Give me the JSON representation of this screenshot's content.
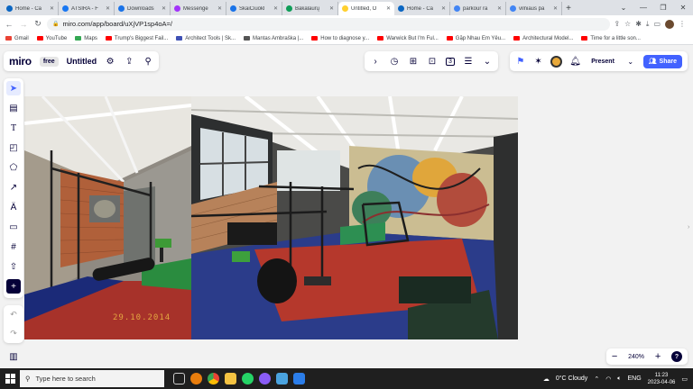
{
  "browser": {
    "tabs": [
      {
        "title": "Home - Ca",
        "favicon_color": "#0b66c2"
      },
      {
        "title": "ATSIRA - F",
        "favicon_color": "#1877f2"
      },
      {
        "title": "Downloads",
        "favicon_color": "#1a73e8"
      },
      {
        "title": "Messenge",
        "favicon_color": "#a334fa"
      },
      {
        "title": "SkaiČiuokl",
        "favicon_color": "#1a73e8"
      },
      {
        "title": "Bakalaurų",
        "favicon_color": "#0f9d58"
      },
      {
        "title": "Untitled, O",
        "favicon_color": "#ffd02f",
        "active": true
      },
      {
        "title": "Home - Ca",
        "favicon_color": "#0b66c2"
      },
      {
        "title": "parkour ra",
        "favicon_color": "#4285f4"
      },
      {
        "title": "vilniaus pa",
        "favicon_color": "#4285f4"
      }
    ],
    "url": "miro.com/app/board/uXjVP1sp4oA=/",
    "bookmarks": [
      {
        "label": "Gmail",
        "color": "#ea4335"
      },
      {
        "label": "YouTube",
        "color": "#ff0000"
      },
      {
        "label": "Maps",
        "color": "#34a853"
      },
      {
        "label": "Trump's Biggest Fail...",
        "color": "#ff0000"
      },
      {
        "label": "Architect Tools | Sk...",
        "color": "#3f51b5"
      },
      {
        "label": "Mantas Ambraška |...",
        "color": "#555555"
      },
      {
        "label": "How to diagnose y...",
        "color": "#ff0000"
      },
      {
        "label": "Warwick But I'm Ful...",
        "color": "#ff0000"
      },
      {
        "label": "Gặp Nhau Em Yêu...",
        "color": "#ff0000"
      },
      {
        "label": "Architectural Model...",
        "color": "#ff0000"
      },
      {
        "label": "Time for a little son...",
        "color": "#ff0000"
      }
    ]
  },
  "miro": {
    "logo": "miro",
    "plan_badge": "free",
    "board_title": "Untitled",
    "present_label": "Present",
    "share_label": "Share",
    "zoom_level": "240%",
    "zoom_out": "−",
    "zoom_in": "+",
    "help": "?",
    "toolbar_count": "3",
    "accent": "#4262ff",
    "photo_date_stamp": "29.10.2014"
  },
  "taskbar": {
    "search_placeholder": "Type here to search",
    "weather": "0°C  Cloudy",
    "language": "ENG",
    "time": "11:23",
    "date": "2023-04-06"
  }
}
